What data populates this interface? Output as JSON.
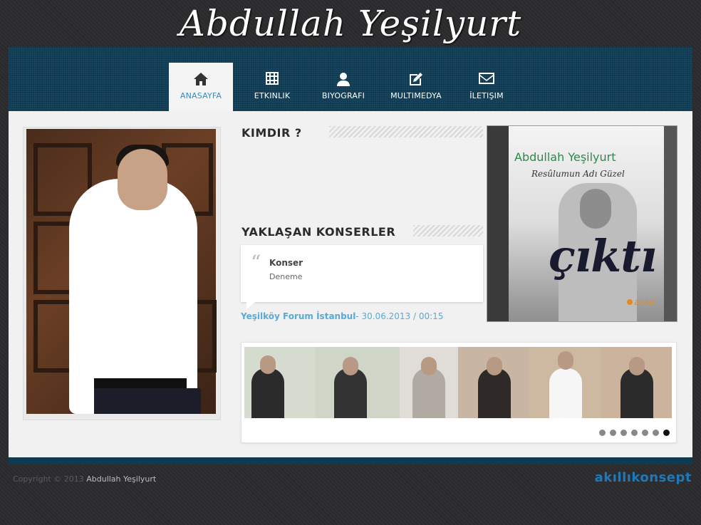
{
  "site": {
    "logo": "Abdullah Yeşilyurt"
  },
  "nav": {
    "items": [
      {
        "label": "ANASAYFA",
        "icon": "home-icon",
        "active": true
      },
      {
        "label": "ETKINLIK",
        "icon": "calendar-grid-icon",
        "active": false
      },
      {
        "label": "BIYOGRAFI",
        "icon": "user-icon",
        "active": false
      },
      {
        "label": "MULTIMEDYA",
        "icon": "edit-icon",
        "active": false
      },
      {
        "label": "İLETIŞIM",
        "icon": "envelope-icon",
        "active": false
      }
    ]
  },
  "kimdir": {
    "title": "KIMDIR ?"
  },
  "concerts": {
    "title": "YAKLAŞAN KONSERLER",
    "item_name": "Konser",
    "item_desc": "Deneme",
    "venue": "Yeşilköy Forum İstanbul",
    "datetime": "- 30.06.2013 / 00:15"
  },
  "album": {
    "artist": "Abdullah Yeşilyurt",
    "subtitle": "Resûlumun Adı Güzel",
    "banner": "çıktı",
    "label": "azad"
  },
  "slider": {
    "dots": 7,
    "active_index": 6
  },
  "footer": {
    "copyright": "Copyright © 2013 ",
    "name": "Abdullah Yeşilyurt",
    "brand_a": "akıllı",
    "brand_b": "konsept"
  },
  "colors": {
    "nav_bg": "#0e3a52",
    "accent_link": "#5aa9d6",
    "brand": "#1f79b8"
  }
}
